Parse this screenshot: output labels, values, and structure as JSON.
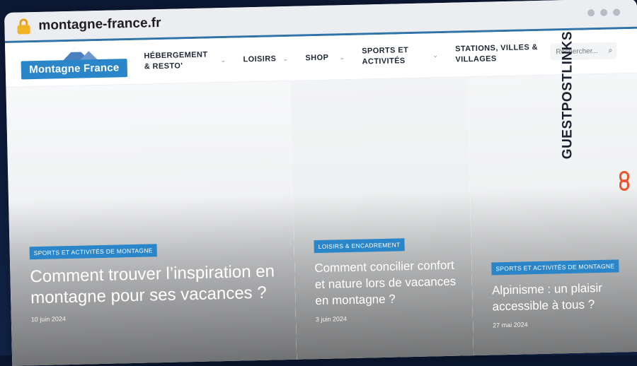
{
  "browser": {
    "url": "montagne-france.fr",
    "lock_icon": "lock-icon",
    "window_dots": [
      "dot",
      "dot",
      "dot"
    ]
  },
  "site": {
    "logo_text": "Montagne France",
    "nav": [
      {
        "label": "HÉBERGEMENT & RESTO'"
      },
      {
        "label": "LOISIRS"
      },
      {
        "label": "SHOP"
      },
      {
        "label": "SPORTS ET ACTIVITÉS"
      },
      {
        "label": "STATIONS, VILLES & VILLAGES"
      }
    ],
    "search_placeholder": "Rechercher...",
    "search_icon": "magnifier-icon"
  },
  "cards": [
    {
      "category": "SPORTS ET ACTIVITÉS DE MONTAGNE",
      "title": "Comment trouver l’inspiration en montagne pour ses vacances ?",
      "date": "10 juin 2024"
    },
    {
      "category": "LOISIRS & ENCADREMENT",
      "title": "Comment concilier confort et nature lors de vacances en montagne ?",
      "date": "3 juin 2024"
    },
    {
      "category": "SPORTS ET ACTIVITÉS DE MONTAGNE",
      "title": "Alpinisme : un plaisir accessible à tous ?",
      "date": "27 mai 2024"
    }
  ],
  "watermark": {
    "text": "GUESTPOSTLINKS",
    "icon": "chain-link-icon",
    "accent": "#f0532b"
  },
  "colors": {
    "brand_blue": "#2a86c8",
    "urlbar_accent": "#2f73a8",
    "lock": "#f2b322"
  }
}
